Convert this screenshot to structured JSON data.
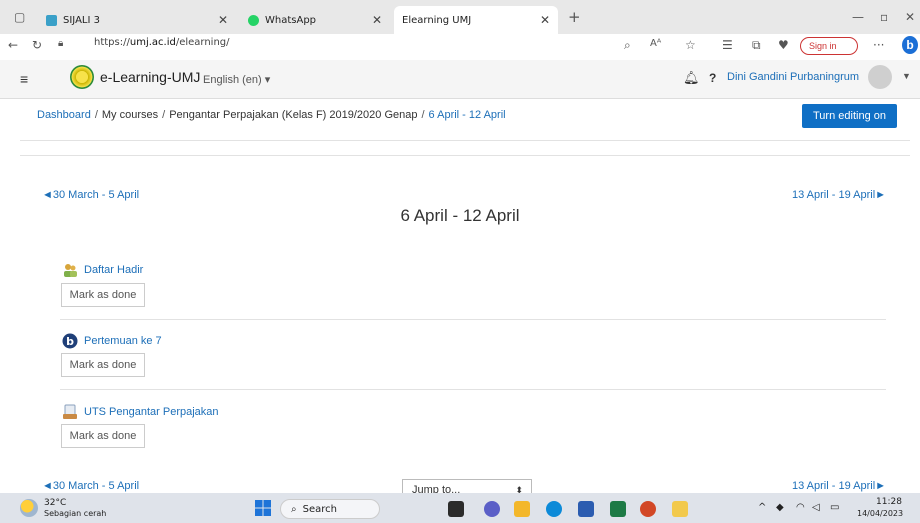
{
  "browser": {
    "tabs": [
      {
        "label": "SIJALI 3",
        "active": false
      },
      {
        "label": "WhatsApp",
        "active": false
      },
      {
        "label": "Elearning UMJ",
        "active": true
      }
    ],
    "url_prefix": "https://",
    "url_domain": "umj.ac.id",
    "url_path": "/elearning/",
    "sign_in": "Sign in",
    "more": "···"
  },
  "navbar": {
    "site_name": "e-Learning-UMJ",
    "language": "English (en) ▾",
    "help": "?",
    "user_name": "Dini Gandini Purbaningrum"
  },
  "breadcrumb": {
    "items": [
      "Dashboard",
      "My courses",
      "Pengantar Perpajakan (Kelas F) 2019/2020 Genap",
      "6 April - 12 April"
    ],
    "separator": "/"
  },
  "edit_button": "Turn editing on",
  "week": {
    "title": "6 April - 12 April",
    "prev": "◄30 March - 5 April",
    "next": "13 April - 19 April►"
  },
  "activities": [
    {
      "name": "Daftar Hadir",
      "icon": "attendance-icon",
      "button": "Mark as done"
    },
    {
      "name": "Pertemuan ke 7",
      "icon": "bigbluebutton-icon",
      "button": "Mark as done"
    },
    {
      "name": "UTS Pengantar Perpajakan",
      "icon": "assignment-icon",
      "button": "Mark as done"
    }
  ],
  "jump_to": "Jump to...",
  "taskbar": {
    "temperature": "32°C",
    "weather": "Sebagian cerah",
    "search": "Search",
    "time": "11:28",
    "date": "14/04/2023"
  },
  "colors": {
    "accent": "#0f6fc5",
    "link": "#1d6fb8"
  }
}
